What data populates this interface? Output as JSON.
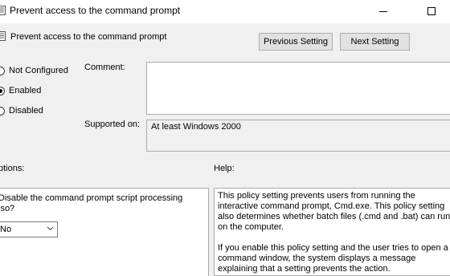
{
  "window": {
    "title": "Prevent access to the command prompt"
  },
  "header": {
    "title": "Prevent access to the command prompt",
    "previous_label": "Previous Setting",
    "next_label": "Next Setting"
  },
  "state": {
    "options": [
      {
        "label": "Not Configured",
        "checked": false
      },
      {
        "label": "Enabled",
        "checked": true
      },
      {
        "label": "Disabled",
        "checked": false
      }
    ]
  },
  "comment": {
    "label": "Comment:",
    "value": ""
  },
  "supported": {
    "label": "Supported on:",
    "value": "At least Windows 2000"
  },
  "options_section": {
    "label": "ptions:",
    "question_line1": "Disable the command prompt script processing",
    "question_line2": "lso?",
    "selected_value": "No"
  },
  "help_section": {
    "label": "Help:",
    "paragraph1": "This policy setting prevents users from running the interactive command prompt, Cmd.exe. This policy setting also determines whether batch files (.cmd and .bat) can run on the computer.",
    "paragraph2": "If you enable this policy setting and the user tries to open a command window, the system displays a message explaining that a setting prevents the action."
  }
}
